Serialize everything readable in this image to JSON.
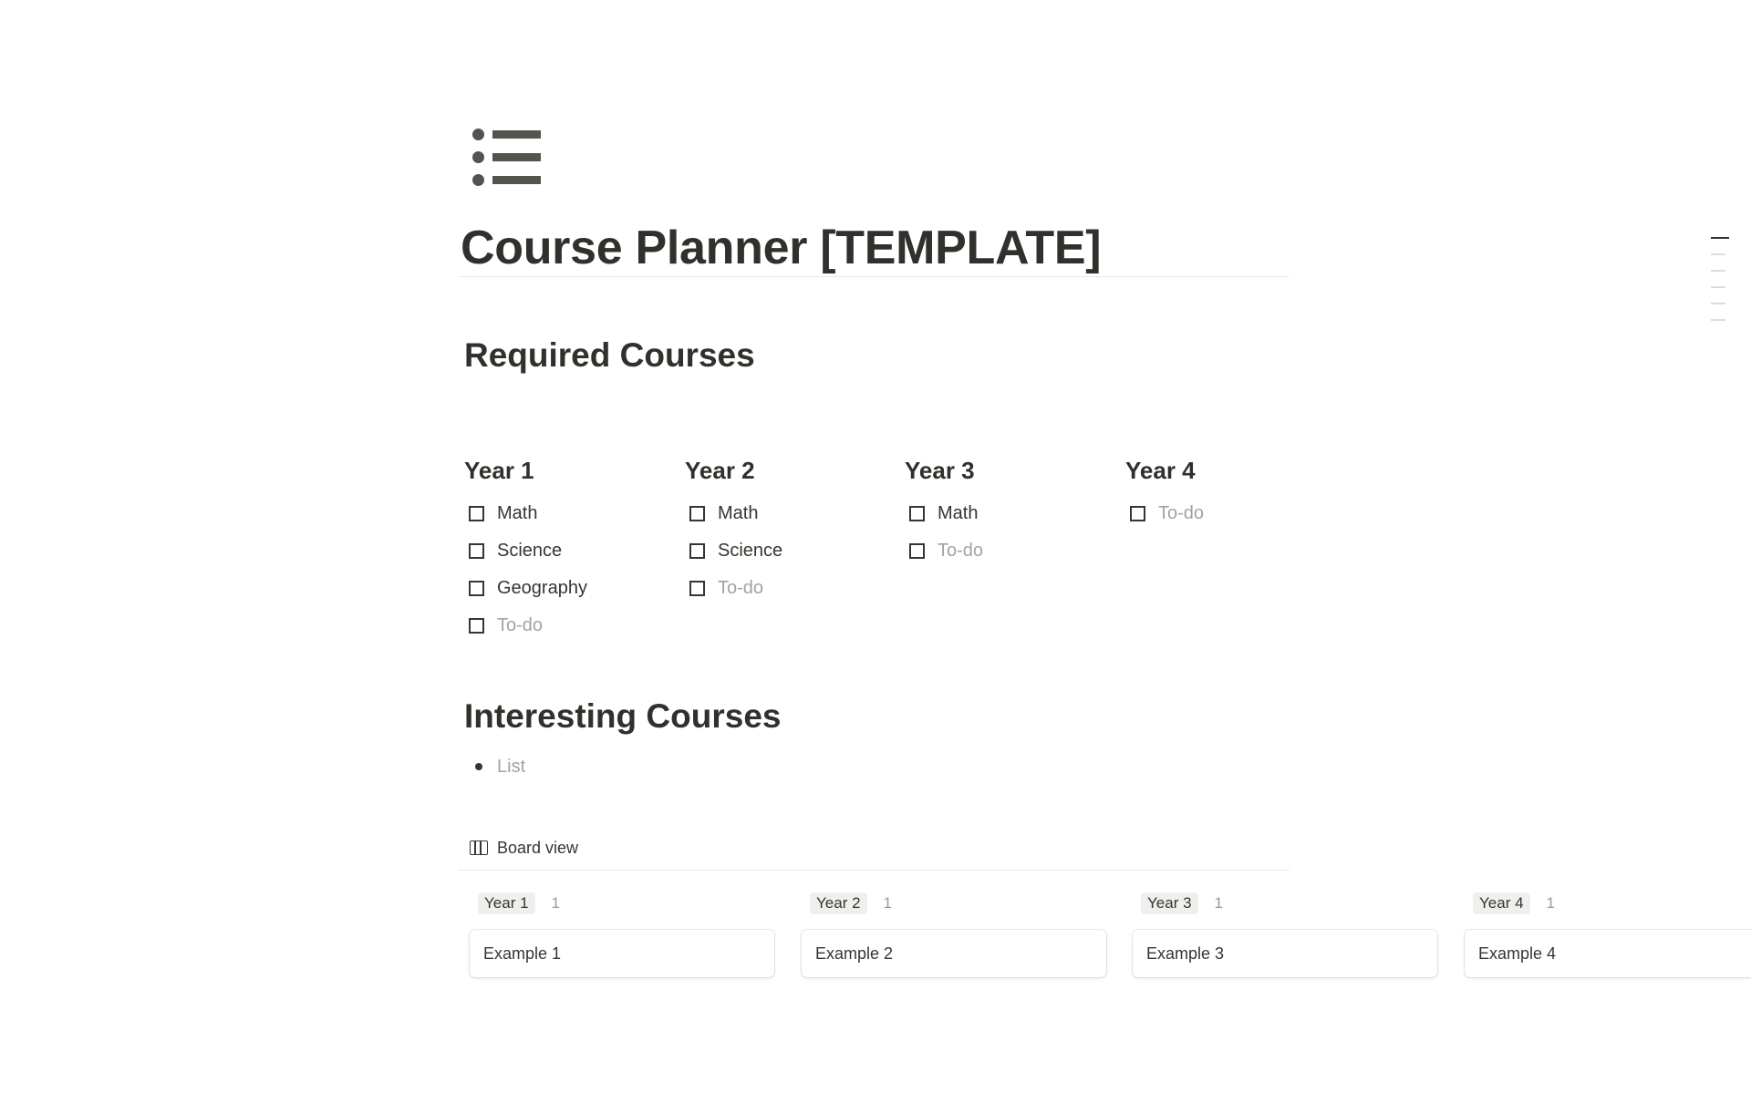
{
  "page": {
    "icon": "bulleted-list-icon",
    "title": "Course Planner [TEMPLATE]"
  },
  "required": {
    "heading": "Required Courses",
    "columns": [
      {
        "title": "Year 1",
        "items": [
          {
            "label": "Math",
            "placeholder": false
          },
          {
            "label": "Science",
            "placeholder": false
          },
          {
            "label": "Geography",
            "placeholder": false
          },
          {
            "label": "To-do",
            "placeholder": true
          }
        ]
      },
      {
        "title": "Year 2",
        "items": [
          {
            "label": "Math",
            "placeholder": false
          },
          {
            "label": "Science",
            "placeholder": false
          },
          {
            "label": "To-do",
            "placeholder": true
          }
        ]
      },
      {
        "title": "Year 3",
        "items": [
          {
            "label": "Math",
            "placeholder": false
          },
          {
            "label": "To-do",
            "placeholder": true
          }
        ]
      },
      {
        "title": "Year 4",
        "items": [
          {
            "label": "To-do",
            "placeholder": true
          }
        ]
      }
    ]
  },
  "interesting": {
    "heading": "Interesting Courses",
    "list_placeholder": "List"
  },
  "board": {
    "view_label": "Board view",
    "view_icon": "board-view-icon",
    "groups": [
      {
        "name": "Year 1",
        "count": "1",
        "card": "Example 1"
      },
      {
        "name": "Year 2",
        "count": "1",
        "card": "Example 2"
      },
      {
        "name": "Year 3",
        "count": "1",
        "card": "Example 3"
      },
      {
        "name": "Year 4",
        "count": "1",
        "card": "Example 4"
      }
    ]
  },
  "colors": {
    "text": "#37352f",
    "placeholder": "#a5a29e",
    "pill_bg": "#efefed"
  }
}
